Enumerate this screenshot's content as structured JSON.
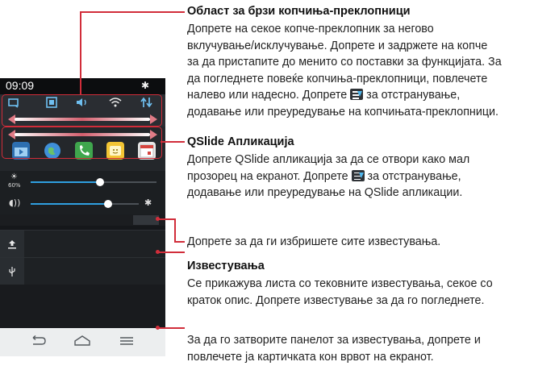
{
  "phone": {
    "time": "09:09",
    "brightness_label": "60%",
    "icons": {
      "settings": "gear-icon",
      "toggles": [
        "screen-rotation-icon",
        "qslide-icon",
        "sound-icon",
        "wifi-icon",
        "data-sync-icon"
      ],
      "apps": [
        "video-app-icon",
        "browser-app-icon",
        "phone-app-icon",
        "memo-app-icon",
        "calendar-app-icon"
      ],
      "notifications": [
        "upload-icon",
        "usb-icon"
      ],
      "nav": [
        "back-icon",
        "home-icon",
        "menu-icon"
      ]
    },
    "brightness_level": 0.55,
    "volume_level": 0.72
  },
  "callouts": {
    "toggles_title": "Област за брзи копчиња-преклопници",
    "toggles_line1": "Допрете на секое копче-преклопник за негово",
    "toggles_line2": "вклучување/исклучување. Допрете и задржете на копче",
    "toggles_line3": "за да пристапите до менито со поставки за функцијата. За",
    "toggles_line4": "да погледнете повеќе копчиња-преклопници, повлечете",
    "toggles_line5a": "налево или надесно. Допрете",
    "toggles_line5b": "за отстранување,",
    "toggles_line6": "додавање или преуредување на копчињата-преклопници.",
    "qslide_title": "QSlide Апликација",
    "qslide_line1": "Допрете QSlide апликација за да се отвори како мал",
    "qslide_line2a": "прозорец на екранот. Допрете",
    "qslide_line2b": "за отстранување,",
    "qslide_line3": "додавање или преуредување на QSlide апликации.",
    "clear_text": "Допрете за да ги избришете сите известувања.",
    "notif_title": "Известувања",
    "notif_line1": "Се прикажува листа со тековните известувања, секое со",
    "notif_line2": "краток опис. Допрете известување за да го погледнете.",
    "close_line1": "За да го затворите панелот за известувања, допрете и",
    "close_line2": "повлечете ја картичката кон врвот на екранот."
  },
  "colors": {
    "callout": "#d12d3a",
    "accent": "#2f9fe0"
  }
}
